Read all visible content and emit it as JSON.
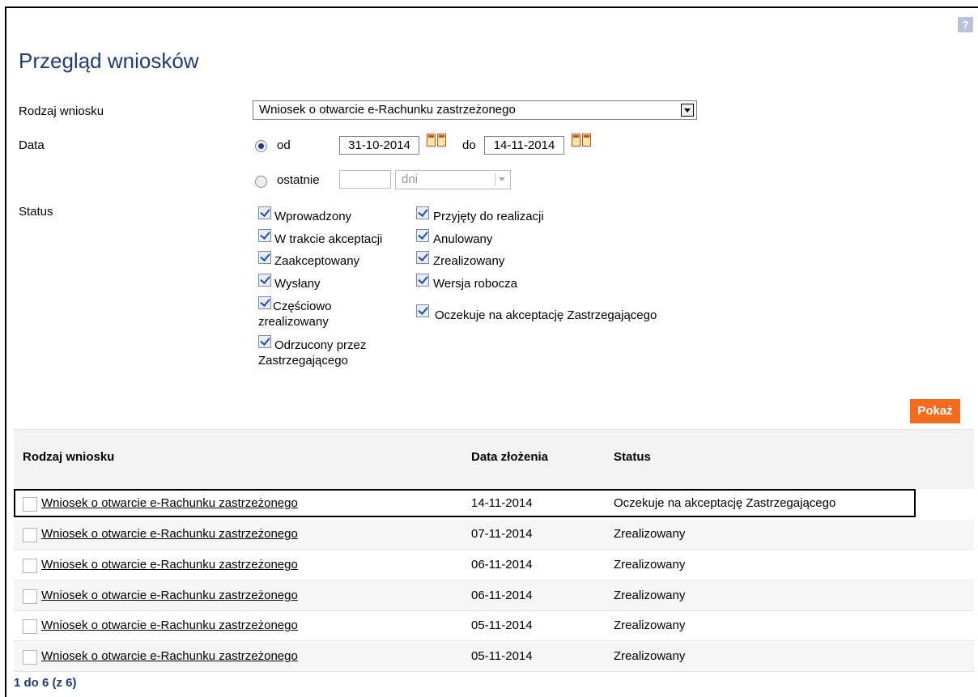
{
  "help_label": "?",
  "page_title": "Przegląd wniosków",
  "filters": {
    "type_label": "Rodzaj wniosku",
    "type_value": "Wniosek o otwarcie e-Rachunku zastrzeżonego",
    "date_label": "Data",
    "from_label": "od",
    "from_value": "31-10-2014",
    "to_label": "do",
    "to_value": "14-11-2014",
    "last_label": "ostatnie",
    "last_value": "",
    "last_unit": "dni",
    "status_label": "Status"
  },
  "statuses_left": [
    {
      "line1": "Wprowadzony",
      "line2": ""
    },
    {
      "line1": "W trakcie akceptacji",
      "line2": ""
    },
    {
      "line1": "Zaakceptowany",
      "line2": ""
    },
    {
      "line1": "Wysłany",
      "line2": ""
    },
    {
      "line1": "Częściowo",
      "line2": "zrealizowany"
    },
    {
      "line1": "Odrzucony przez",
      "line2": "Zastrzegającego"
    }
  ],
  "statuses_right": [
    "Przyjęty do realizacji",
    "Anulowany",
    "Zrealizowany",
    "Wersja robocza",
    "Oczekuje na akceptację Zastrzegającego"
  ],
  "show_button": "Pokaż",
  "table": {
    "headers": [
      "Rodzaj wniosku",
      "Data złożenia",
      "Status"
    ],
    "rows": [
      {
        "type": "Wniosek o otwarcie e-Rachunku zastrzeżonego",
        "date": "14-11-2014",
        "status": "Oczekuje na akceptację Zastrzegającego"
      },
      {
        "type": "Wniosek o otwarcie e-Rachunku zastrzeżonego",
        "date": "07-11-2014",
        "status": "Zrealizowany"
      },
      {
        "type": "Wniosek o otwarcie e-Rachunku zastrzeżonego",
        "date": "06-11-2014",
        "status": "Zrealizowany"
      },
      {
        "type": "Wniosek o otwarcie e-Rachunku zastrzeżonego",
        "date": "06-11-2014",
        "status": "Zrealizowany"
      },
      {
        "type": "Wniosek o otwarcie e-Rachunku zastrzeżonego",
        "date": "05-11-2014",
        "status": "Zrealizowany"
      },
      {
        "type": "Wniosek o otwarcie e-Rachunku zastrzeżonego",
        "date": "05-11-2014",
        "status": "Zrealizowany"
      }
    ]
  },
  "pager": "1 do 6 (z 6)"
}
